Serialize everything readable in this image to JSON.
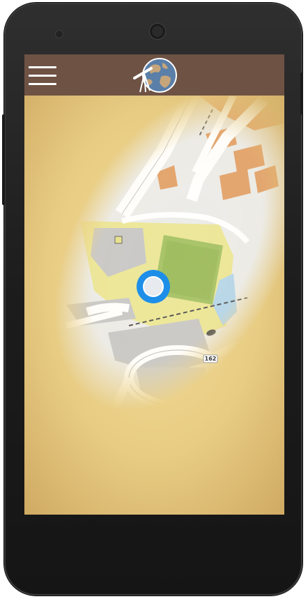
{
  "app": {
    "menu_icon": "hamburger-menu-icon",
    "logo_icon": "telescope-globe-logo-icon",
    "colors": {
      "appbar": "#6e5244",
      "parchment": "#e9cd83",
      "location_dot": "#1e8fe8"
    }
  },
  "map": {
    "road_label": "162",
    "location_marker": "current-location-icon"
  }
}
